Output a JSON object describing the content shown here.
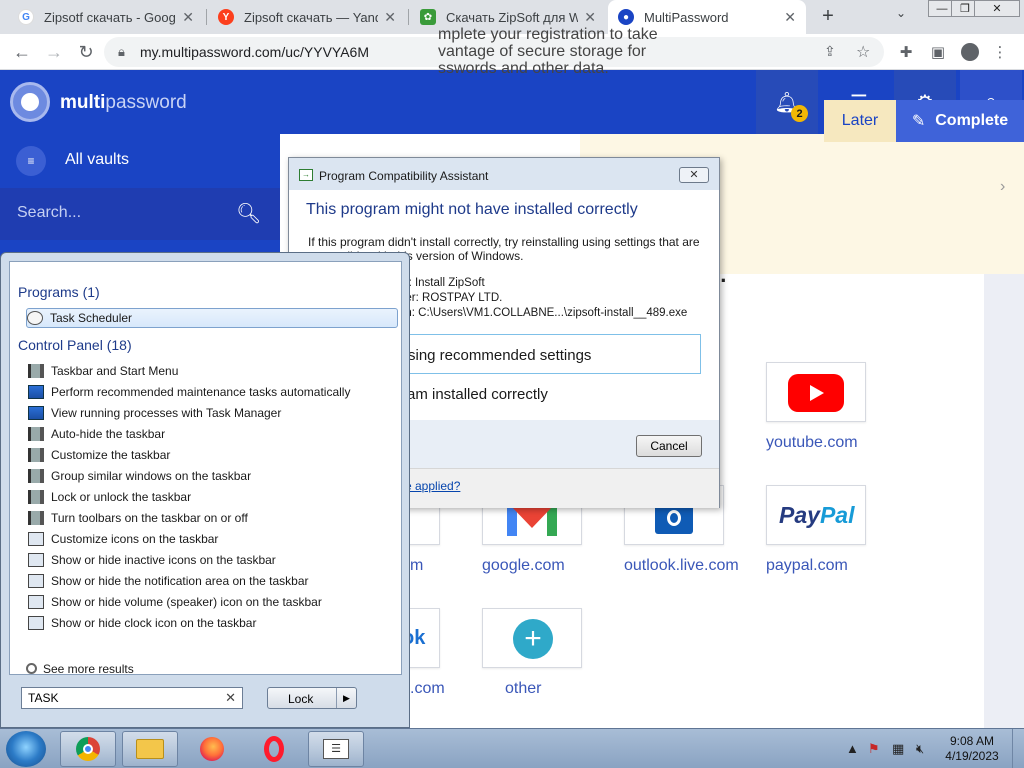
{
  "browser": {
    "tabs": [
      {
        "title": "Zipsotf скачать - Google",
        "favicon": "google-g-icon"
      },
      {
        "title": "Zipsoft скачать — Yande",
        "favicon": "yandex-y-icon"
      },
      {
        "title": "Скачать ZipSoft для Wind",
        "favicon": "zipsoft-leaf-icon"
      },
      {
        "title": "MultiPassword",
        "favicon": "multipassword-icon"
      }
    ],
    "url": "my.multipassword.com/uc/YYVYA6M"
  },
  "app": {
    "brand_bold": "multi",
    "brand_light": "password",
    "notification_count": "2",
    "sidebar": {
      "vaults_label": "All vaults",
      "search_placeholder": "Search..."
    },
    "banner": {
      "text": "mplete your registration to take vantage of secure storage for sswords and other data.",
      "later_label": "Later",
      "complete_label": "Complete"
    },
    "tiles": [
      {
        "label": "youtube.com",
        "icon": "youtube-icon"
      },
      {
        "label": "google.com",
        "icon": "gmail-icon"
      },
      {
        "label": "outlook.live.com",
        "icon": "outlook-icon"
      },
      {
        "label": "paypal.com",
        "icon": "paypal-icon"
      },
      {
        "label": "other",
        "icon": "add-icon"
      }
    ],
    "partial_labels": {
      "left_u": "u",
      "left_m": "m",
      "left_ok": "ok",
      "left_com": ".com",
      "paypal_logo": "PayPal"
    }
  },
  "dialog": {
    "title": "Program Compatibility Assistant",
    "heading": "This program might not have installed correctly",
    "description": "If this program didn't install correctly, try reinstalling using settings that are compatible with this version of Windows.",
    "info_lines": [
      "m: Install ZipSoft",
      "her: ROSTPAY LTD.",
      "on: C:\\Users\\VM1.COLLABNE...\\zipsoft-install__489.exe"
    ],
    "option_recommended": "sing recommended settings",
    "option_installed": "am installed correctly",
    "cancel_label": "Cancel",
    "footer_link": "re applied?"
  },
  "start_menu": {
    "programs_header": "Programs (1)",
    "programs": [
      "Task Scheduler"
    ],
    "control_panel_header": "Control Panel (18)",
    "control_panel_items": [
      "Taskbar and Start Menu",
      "Perform recommended maintenance tasks automatically",
      "View running processes with Task Manager",
      "Auto-hide the taskbar",
      "Customize the taskbar",
      "Group similar windows on the taskbar",
      "Lock or unlock the taskbar",
      "Turn toolbars on the taskbar on or off",
      "Customize icons on the taskbar",
      "Show or hide inactive icons on the taskbar",
      "Show or hide the notification area on the taskbar",
      "Show or hide volume (speaker) icon on the taskbar",
      "Show or hide clock icon on the taskbar"
    ],
    "see_more": "See more results",
    "search_value": "TASK",
    "lock_label": "Lock"
  },
  "taskbar": {
    "time": "9:08 AM",
    "date": "4/19/2023",
    "apps": [
      "chrome-icon",
      "file-explorer-icon",
      "firefox-icon",
      "opera-icon",
      "document-list-icon"
    ]
  },
  "colors": {
    "brand_blue": "#1a44c4",
    "complete_blue": "#3f63d9",
    "banner_bg": "#fdf7e4",
    "notification_badge": "#f2b705"
  }
}
